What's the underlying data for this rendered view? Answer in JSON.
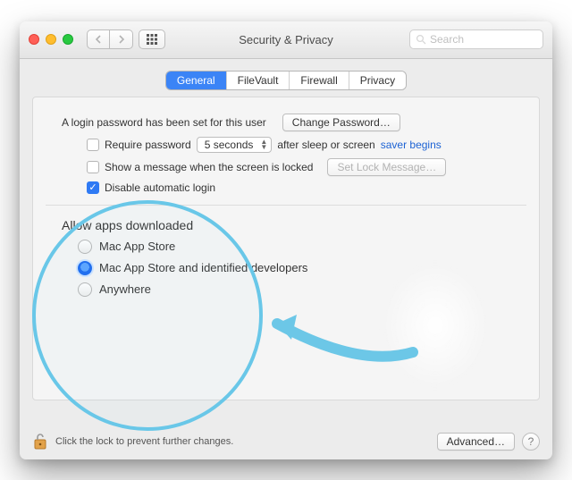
{
  "titlebar": {
    "title": "Security & Privacy",
    "search_placeholder": "Search"
  },
  "tabs": [
    "General",
    "FileVault",
    "Firewall",
    "Privacy"
  ],
  "active_tab": 0,
  "login": {
    "text": "A login password has been set for this user",
    "change_btn": "Change Password…",
    "require_label": "Require password",
    "require_select": "5 seconds",
    "require_after": "after sleep or screen ",
    "saver_link": "saver begins",
    "show_msg": "Show a message when the screen is locked",
    "set_lock_btn": "Set Lock Message…",
    "disable_auto": "Disable automatic login"
  },
  "allow": {
    "heading_visible": "Allow apps downloaded",
    "options": [
      "Mac App Store",
      "Mac App Store and identified developers",
      "Anywhere"
    ],
    "option_visible_1": "Mac App Store an",
    "selected": 1
  },
  "footer": {
    "lock_text": "Click the lock to prevent further changes.",
    "advanced": "Advanced…"
  }
}
